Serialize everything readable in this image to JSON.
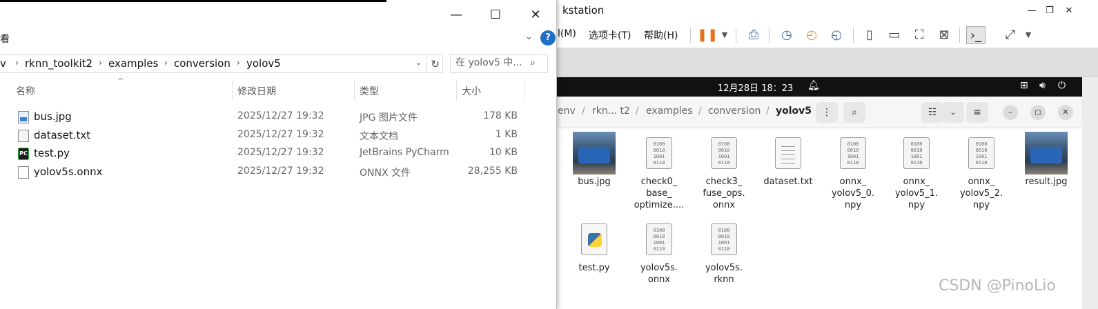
{
  "explorer": {
    "ribbon_label": "看",
    "help_icon": "?",
    "address": [
      "v",
      "rknn_toolkit2",
      "examples",
      "conversion",
      "yolov5"
    ],
    "search_placeholder": "在 yolov5 中...",
    "columns": {
      "name": "名称",
      "date": "修改日期",
      "type": "类型",
      "size": "大小"
    },
    "files": [
      {
        "name": "bus.jpg",
        "date": "2025/12/27 19:32",
        "type": "JPG 图片文件",
        "size": "178 KB",
        "icon": "jpg-file-icon"
      },
      {
        "name": "dataset.txt",
        "date": "2025/12/27 19:32",
        "type": "文本文档",
        "size": "1 KB",
        "icon": "text-file-icon"
      },
      {
        "name": "test.py",
        "date": "2025/12/27 19:32",
        "type": "JetBrains PyCharm",
        "size": "10 KB",
        "icon": "pycharm-file-icon"
      },
      {
        "name": "yolov5s.onnx",
        "date": "2025/12/27 19:32",
        "type": "ONNX 文件",
        "size": "28,255 KB",
        "icon": "blank-file-icon"
      }
    ],
    "pycharm_badge": "PC"
  },
  "vmware": {
    "title": "kstation",
    "menus": [
      "l(M)",
      "选项卡(T)",
      "帮助(H)"
    ]
  },
  "ubuntu": {
    "clock": "12月28日  18：23"
  },
  "nautilus": {
    "breadcrumbs": [
      "env",
      "rkn... t2",
      "examples",
      "conversion",
      "yolov5"
    ],
    "files": [
      {
        "name": [
          "bus.jpg"
        ],
        "kind": "photo"
      },
      {
        "name": [
          "check0_",
          "base_",
          "optimize...."
        ],
        "kind": "binary"
      },
      {
        "name": [
          "check3_",
          "fuse_ops.",
          "onnx"
        ],
        "kind": "binary"
      },
      {
        "name": [
          "dataset.txt"
        ],
        "kind": "text"
      },
      {
        "name": [
          "onnx_",
          "yolov5_0.",
          "npy"
        ],
        "kind": "binary"
      },
      {
        "name": [
          "onnx_",
          "yolov5_1.",
          "npy"
        ],
        "kind": "binary"
      },
      {
        "name": [
          "onnx_",
          "yolov5_2.",
          "npy"
        ],
        "kind": "binary"
      },
      {
        "name": [
          "result.jpg"
        ],
        "kind": "photo"
      },
      {
        "name": [
          "test.py"
        ],
        "kind": "python"
      },
      {
        "name": [
          "yolov5s.",
          "onnx"
        ],
        "kind": "binary"
      },
      {
        "name": [
          "yolov5s.",
          "rknn"
        ],
        "kind": "binary"
      }
    ],
    "binary_glyph": [
      "0100",
      "0010",
      "1001",
      "0110"
    ]
  },
  "watermark": "CSDN @PinoLio"
}
